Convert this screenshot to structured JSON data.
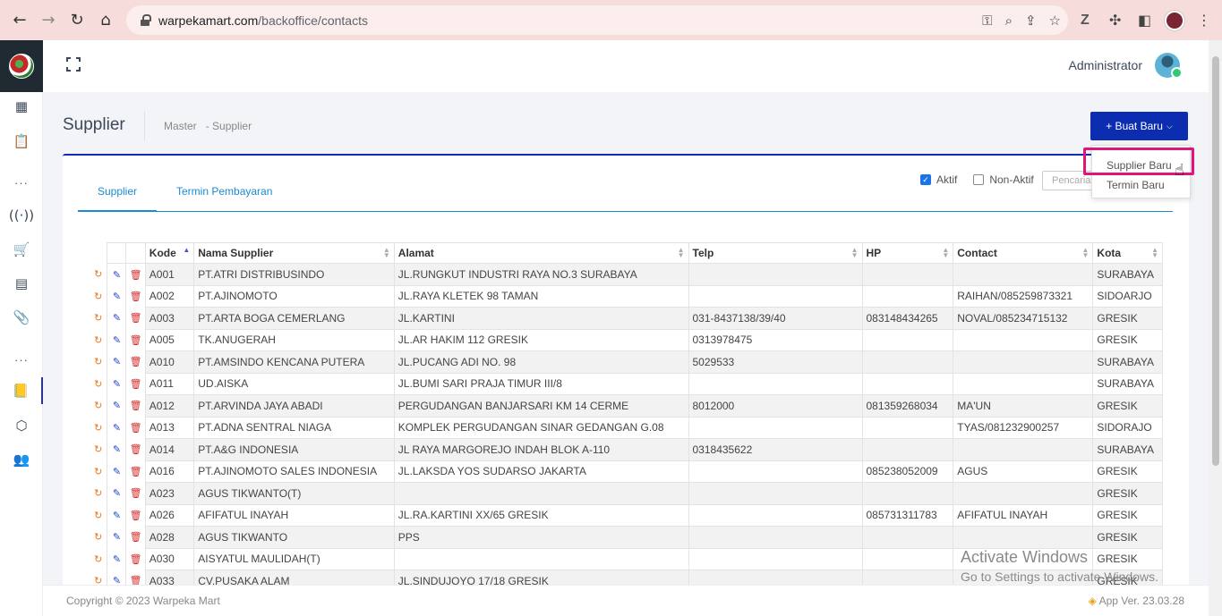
{
  "browser": {
    "url_host": "warpekamart.com",
    "url_path": "/backoffice/contacts"
  },
  "header": {
    "user_name": "Administrator"
  },
  "page": {
    "title": "Supplier",
    "breadcrumb_root": "Master",
    "breadcrumb_current": "- Supplier",
    "new_button_label": "+ Buat Baru"
  },
  "dropdown": {
    "items": [
      "Supplier Baru",
      "Termin Baru"
    ]
  },
  "tabs": [
    "Supplier",
    "Termin Pembayaran"
  ],
  "filters": {
    "active_label": "Aktif",
    "active_checked": true,
    "inactive_label": "Non-Aktif",
    "inactive_checked": false,
    "search_placeholder": "Pencaria"
  },
  "table": {
    "columns": [
      "Kode",
      "Nama Supplier",
      "Alamat",
      "Telp",
      "HP",
      "Contact",
      "Kota"
    ],
    "rows": [
      [
        "A001",
        "PT.ATRI DISTRIBUSINDO",
        "JL.RUNGKUT INDUSTRI RAYA NO.3 SURABAYA",
        "",
        "",
        "",
        "SURABAYA"
      ],
      [
        "A002",
        "PT.AJINOMOTO",
        "JL.RAYA KLETEK 98 TAMAN",
        "",
        "",
        "RAIHAN/085259873321",
        "SIDOARJO"
      ],
      [
        "A003",
        "PT.ARTA BOGA CEMERLANG",
        "JL.KARTINI",
        "031-8437138/39/40",
        "083148434265",
        "NOVAL/085234715132",
        "GRESIK"
      ],
      [
        "A005",
        "TK.ANUGERAH",
        "JL.AR HAKIM 112 GRESIK",
        "0313978475",
        "",
        "",
        "GRESIK"
      ],
      [
        "A010",
        "PT.AMSINDO KENCANA PUTERA",
        "JL.PUCANG ADI NO. 98",
        "5029533",
        "",
        "",
        "SURABAYA"
      ],
      [
        "A011",
        "UD.AISKA",
        "JL.BUMI SARI PRAJA TIMUR III/8",
        "",
        "",
        "",
        "SURABAYA"
      ],
      [
        "A012",
        "PT.ARVINDA JAYA ABADI",
        "PERGUDANGAN BANJARSARI KM 14 CERME",
        "8012000",
        "081359268034",
        "MA'UN",
        "GRESIK"
      ],
      [
        "A013",
        "PT.ADNA SENTRAL NIAGA",
        "KOMPLEK PERGUDANGAN SINAR GEDANGAN G.08",
        "",
        "",
        "TYAS/081232900257",
        "SIDORAJO"
      ],
      [
        "A014",
        "PT.A&G INDONESIA",
        "JL RAYA MARGOREJO INDAH BLOK A-110",
        "0318435622",
        "",
        "",
        "SURABAYA"
      ],
      [
        "A016",
        "PT.AJINOMOTO SALES INDONESIA",
        "JL.LAKSDA YOS SUDARSO JAKARTA",
        "",
        "085238052009",
        "AGUS",
        "GRESIK"
      ],
      [
        "A023",
        "AGUS TIKWANTO(T)",
        "",
        "",
        "",
        "",
        "GRESIK"
      ],
      [
        "A026",
        "AFIFATUL INAYAH",
        "JL.RA.KARTINI XX/65 GRESIK",
        "",
        "085731311783",
        "AFIFATUL INAYAH",
        "GRESIK"
      ],
      [
        "A028",
        "AGUS TIKWANTO",
        "PPS",
        "",
        "",
        "",
        "GRESIK"
      ],
      [
        "A030",
        "AISYATUL MAULIDAH(T)",
        "",
        "",
        "",
        "",
        "GRESIK"
      ],
      [
        "A033",
        "CV.PUSAKA ALAM",
        "JL.SINDUJOYO 17/18 GRESIK",
        "",
        "",
        "",
        "GRESIK"
      ]
    ]
  },
  "footer": {
    "copyright": "Copyright © 2023 Warpeka Mart",
    "version": "App Ver. 23.03.28"
  },
  "watermark": {
    "line1": "Activate Windows",
    "line2": "Go to Settings to activate Windows."
  },
  "colors": {
    "primary": "#0d2db1",
    "tab_accent": "#1a8bd2",
    "highlight": "#e0157a"
  }
}
